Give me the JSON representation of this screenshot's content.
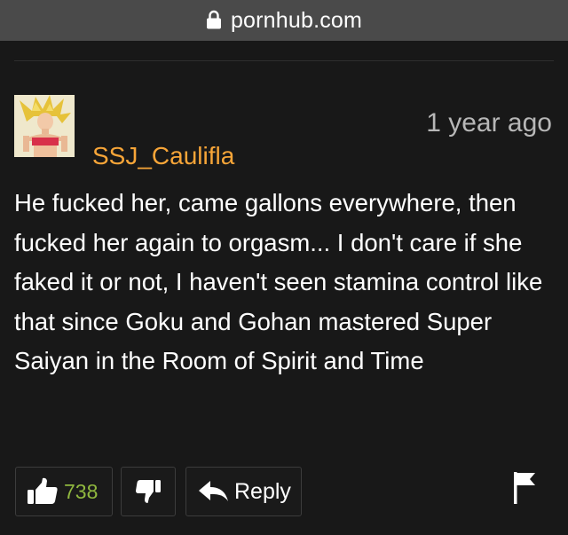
{
  "browser": {
    "url": "pornhub.com",
    "lock_icon": "lock-icon"
  },
  "comment": {
    "username": "SSJ_Caulifla",
    "timestamp": "1 year ago",
    "body": "He fucked her, came gallons everywhere, then fucked her again to orgasm... I don't care if she faked it or not, I haven't seen stamina control like that since Goku and Gohan mastered Super Saiyan in the Room of Spirit and Time",
    "avatar_icon": "user-avatar"
  },
  "actions": {
    "like_count": "738",
    "like_icon": "thumbs-up-icon",
    "dislike_icon": "thumbs-down-icon",
    "reply_label": "Reply",
    "reply_icon": "reply-arrow-icon",
    "flag_icon": "flag-icon"
  },
  "colors": {
    "background": "#181818",
    "url_bar": "#4a4a4a",
    "username": "#f7a538",
    "like_count": "#90b83f",
    "timestamp": "#b7b7b7"
  }
}
